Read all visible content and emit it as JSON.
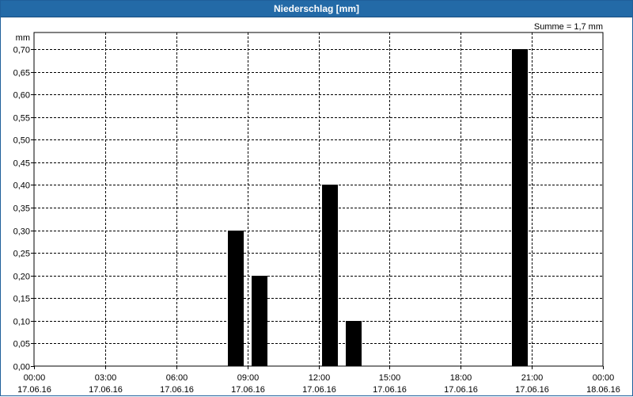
{
  "title": "Niederschlag [mm]",
  "sum_label": "Summe = 1,7 mm",
  "y_unit": "mm",
  "colors": {
    "title_bar": "#236aa7",
    "bar": "#000000",
    "grid": "#000000"
  },
  "chart_data": {
    "type": "bar",
    "title": "Niederschlag [mm]",
    "ylabel": "mm",
    "ylim": [
      0,
      0.7
    ],
    "yticks": [
      "0,00",
      "0,05",
      "0,10",
      "0,15",
      "0,20",
      "0,25",
      "0,30",
      "0,35",
      "0,40",
      "0,45",
      "0,50",
      "0,55",
      "0,60",
      "0,65",
      "0,70"
    ],
    "xlim_hours": [
      0,
      24
    ],
    "xticks": [
      {
        "time": "00:00",
        "date": "17.06.16"
      },
      {
        "time": "03:00",
        "date": "17.06.16"
      },
      {
        "time": "06:00",
        "date": "17.06.16"
      },
      {
        "time": "09:00",
        "date": "17.06.16"
      },
      {
        "time": "12:00",
        "date": "17.06.16"
      },
      {
        "time": "15:00",
        "date": "17.06.16"
      },
      {
        "time": "18:00",
        "date": "17.06.16"
      },
      {
        "time": "21:00",
        "date": "17.06.16"
      },
      {
        "time": "00:00",
        "date": "18.06.16"
      }
    ],
    "grid": true,
    "bars": [
      {
        "hour": 8.5,
        "value": 0.3
      },
      {
        "hour": 9.5,
        "value": 0.2
      },
      {
        "hour": 12.5,
        "value": 0.4
      },
      {
        "hour": 13.5,
        "value": 0.1
      },
      {
        "hour": 20.5,
        "value": 0.7
      }
    ]
  }
}
